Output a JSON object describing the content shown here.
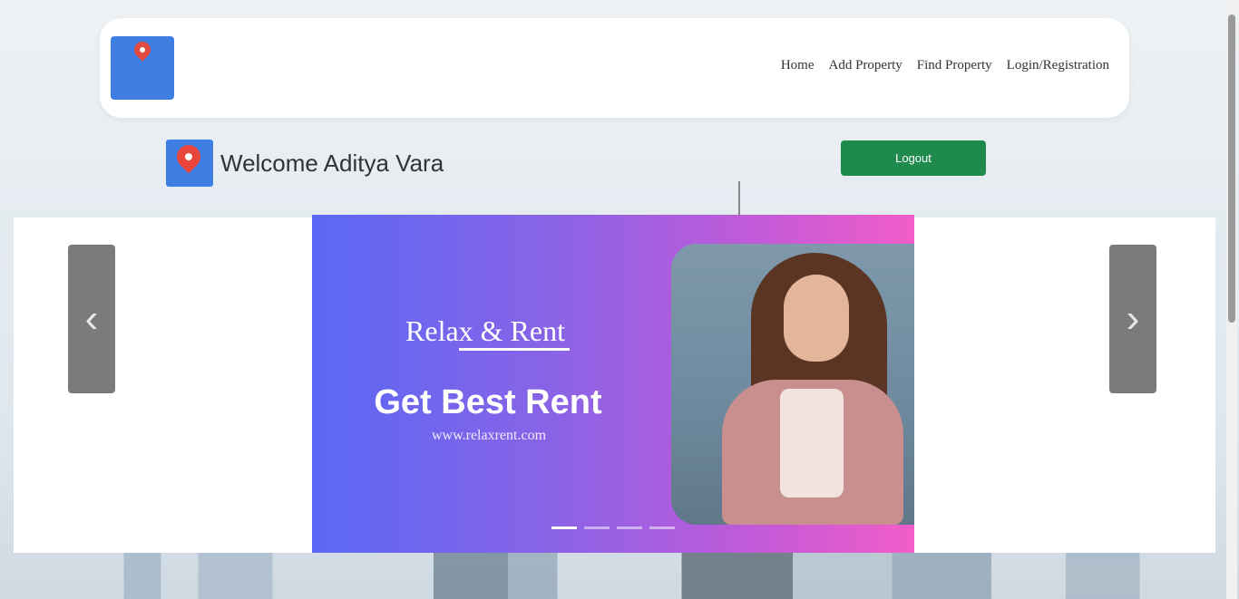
{
  "nav": {
    "links": [
      "Home",
      "Add Property",
      "Find Property",
      "Login/Registration"
    ]
  },
  "welcome": {
    "text": "Welcome Aditya Vara"
  },
  "logout": {
    "label": "Logout"
  },
  "carousel": {
    "prev_symbol": "‹",
    "next_symbol": "›",
    "slide": {
      "brand": "Relax & Rent",
      "headline": "Get Best Rent",
      "url": "www.relaxrent.com"
    },
    "indicator_count": 4,
    "active_index": 0
  },
  "colors": {
    "logout_button": "#1e8a4c",
    "logo_blue": "#3f7fe4",
    "pin_red": "#e9453a",
    "slide_gradient_start": "#5a68f5",
    "slide_gradient_end": "#f25dc8"
  }
}
